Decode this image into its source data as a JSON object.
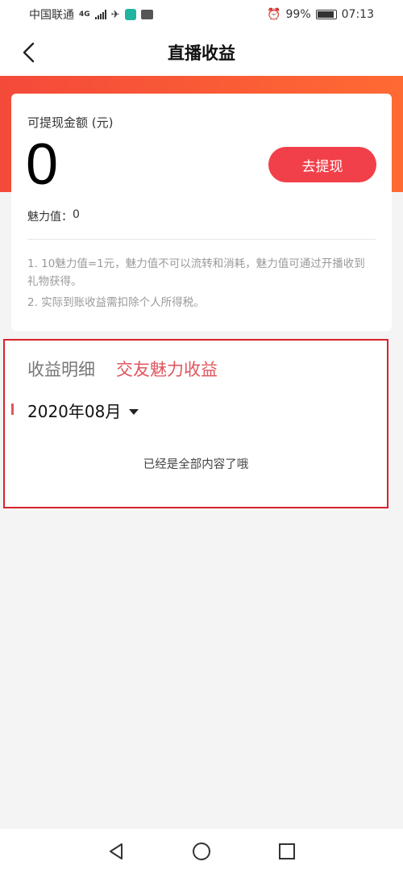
{
  "status_bar": {
    "carrier": "中国联通",
    "network": "4G",
    "battery": "99%",
    "time": "07:13"
  },
  "header": {
    "title": "直播收益",
    "back_icon": "chevron-left-icon"
  },
  "summary": {
    "balance_label": "可提现金额 (元)",
    "balance_value": "0",
    "withdraw_label": "去提现",
    "charm_label": "魅力值：",
    "charm_value": "0",
    "notes": [
      "1. 10魅力值=1元，魅力值不可以流转和消耗，魅力值可通过开播收到礼物获得。",
      "2. 实际到账收益需扣除个人所得税。"
    ]
  },
  "detail": {
    "tabs": [
      {
        "label": "收益明细"
      },
      {
        "label": "交友魅力收益"
      }
    ],
    "month": "2020年08月",
    "end_message": "已经是全部内容了哦"
  },
  "colors": {
    "accent": "#f2404a",
    "gradient_start": "#f44a3a",
    "gradient_end": "#ff6a33",
    "active_tab": "#e0565e"
  }
}
